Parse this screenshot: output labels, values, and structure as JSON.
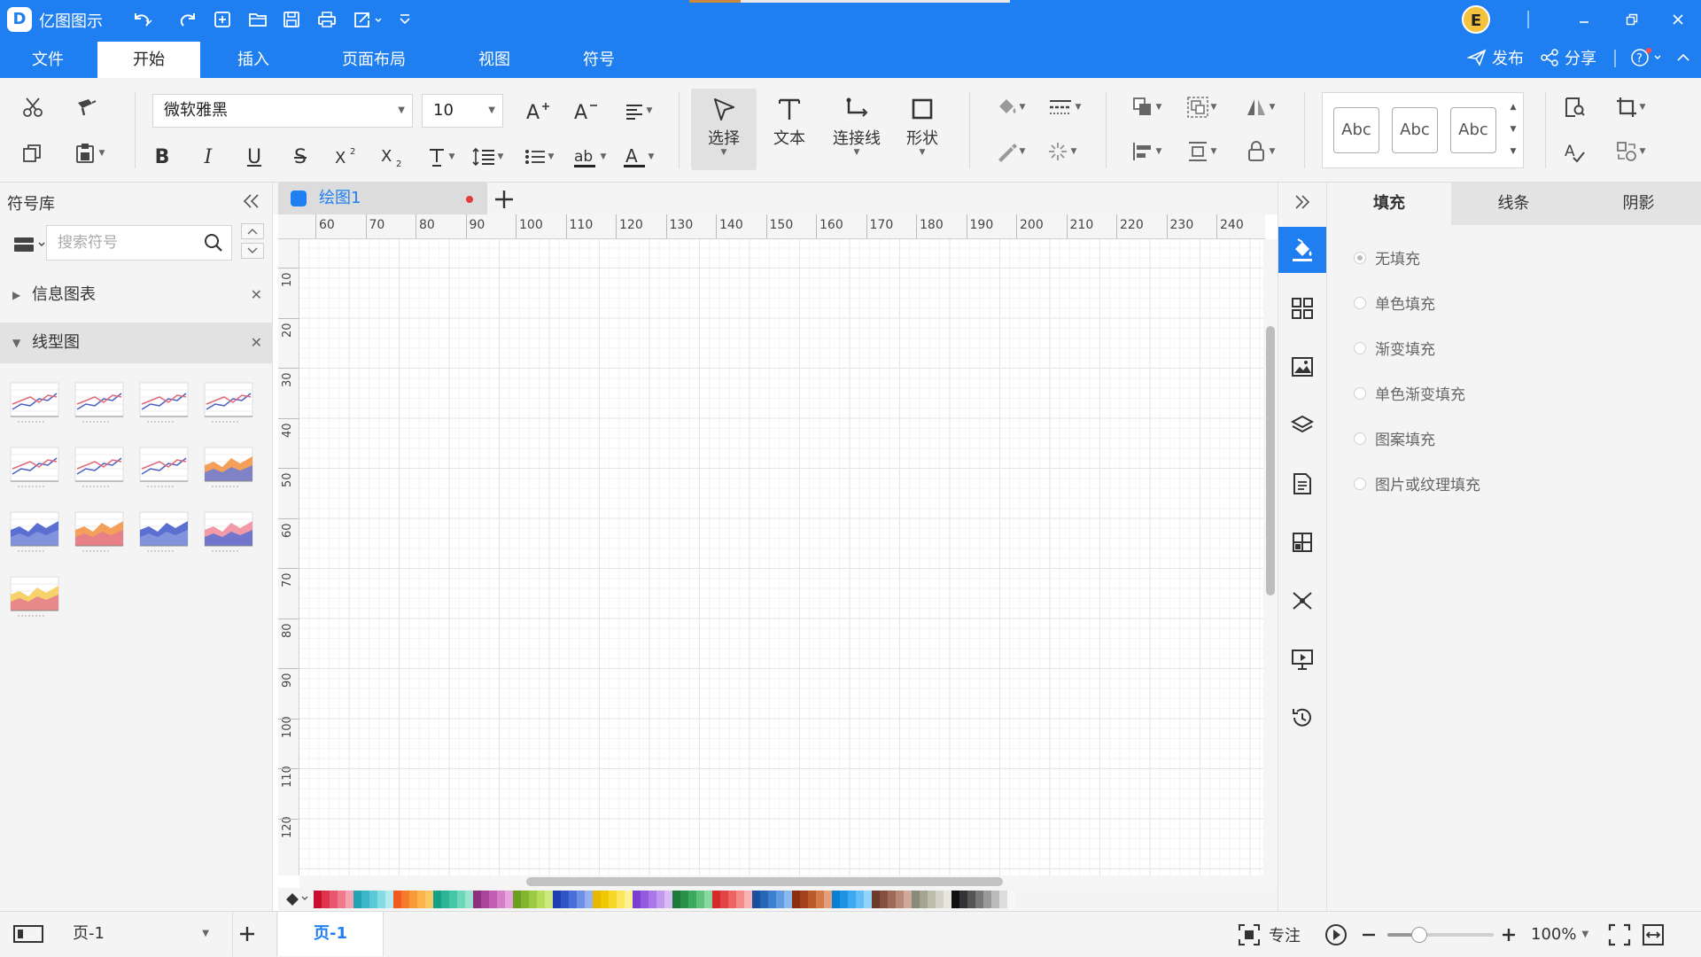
{
  "app": {
    "title": "亿图图示",
    "logo_letter": "D"
  },
  "menu": {
    "tabs": [
      "文件",
      "开始",
      "插入",
      "页面布局",
      "视图",
      "符号"
    ],
    "active": "开始"
  },
  "header": {
    "avatar_letter": "E",
    "publish": "发布",
    "share": "分享"
  },
  "ribbon": {
    "font_name": "微软雅黑",
    "font_size": "10",
    "select_label": "选择",
    "text_label": "文本",
    "connector_label": "连接线",
    "shape_label": "形状",
    "style_samples": [
      "Abc",
      "Abc",
      "Abc"
    ]
  },
  "left_panel": {
    "title": "符号库",
    "search_placeholder": "搜索符号",
    "categories": [
      {
        "name": "信息图表",
        "expanded": false
      },
      {
        "name": "线型图",
        "expanded": true
      }
    ]
  },
  "document": {
    "tab_name": "绘图1"
  },
  "ruler": {
    "top": [
      "60",
      "70",
      "80",
      "90",
      "100",
      "110",
      "120",
      "130",
      "140",
      "150",
      "160",
      "170",
      "180",
      "190",
      "200",
      "210",
      "220",
      "230",
      "240"
    ],
    "left": [
      "10",
      "20",
      "30",
      "40",
      "50",
      "60",
      "70",
      "80",
      "90",
      "100",
      "110",
      "120"
    ]
  },
  "right_panel": {
    "tabs": [
      "填充",
      "线条",
      "阴影"
    ],
    "active_tab": "填充",
    "fill_options": [
      "无填充",
      "单色填充",
      "渐变填充",
      "单色渐变填充",
      "图案填充",
      "图片或纹理填充"
    ],
    "selected_option": "无填充"
  },
  "status": {
    "page_selector": "页-1",
    "page_tab": "页-1",
    "focus_label": "专注",
    "zoom": "100%",
    "zoom_slider_fraction": 0.3
  },
  "colors": {
    "accent": "#1f7ff0",
    "palette": [
      "#c8102e",
      "#e0334e",
      "#e8566f",
      "#f07a8c",
      "#f5a3b0",
      "#24a3b5",
      "#3bb6c6",
      "#5ccad6",
      "#86dce3",
      "#b2ecef",
      "#f25a1f",
      "#f57a2a",
      "#f89a3a",
      "#fab54d",
      "#fcc865",
      "#16a085",
      "#2bb596",
      "#44c7a7",
      "#6dd6bb",
      "#9ae4cf",
      "#8e2f7e",
      "#a8449a",
      "#c25db3",
      "#d77ec8",
      "#e8a4dc",
      "#6b9e1f",
      "#84b52e",
      "#9dca41",
      "#b6dc5c",
      "#cfe982",
      "#1f3fb0",
      "#2f56c7",
      "#4a6fd9",
      "#6e8fe6",
      "#97b1f0",
      "#e6b800",
      "#f0c800",
      "#f7d82a",
      "#fbe65e",
      "#fdf196",
      "#7b3fcf",
      "#9359de",
      "#aa77e8",
      "#c298f0",
      "#d9bbf6",
      "#1e7a3a",
      "#2a914a",
      "#3ca95f",
      "#5ec17c",
      "#8ad8a1",
      "#d42a2a",
      "#e34545",
      "#ee6464",
      "#f58a8a",
      "#fab1b1",
      "#1a4fa0",
      "#2866b8",
      "#3d7fcf",
      "#5f9be0",
      "#8ab9ee",
      "#8a2e0f",
      "#a4401a",
      "#bd5a2c",
      "#d27a4a",
      "#e4a07a",
      "#0a7fd4",
      "#1e93e4",
      "#3ca8ef",
      "#64bef6",
      "#93d4fb",
      "#6b3a2a",
      "#855040",
      "#9e6a58",
      "#b78876",
      "#cfaa9b",
      "#8a8a7a",
      "#a4a493",
      "#bdbdae",
      "#d3d3c7",
      "#e6e6dd",
      "#111111",
      "#333333",
      "#555555",
      "#777777",
      "#999999",
      "#bbbbbb",
      "#dddddd",
      "#f7f7f7"
    ]
  }
}
